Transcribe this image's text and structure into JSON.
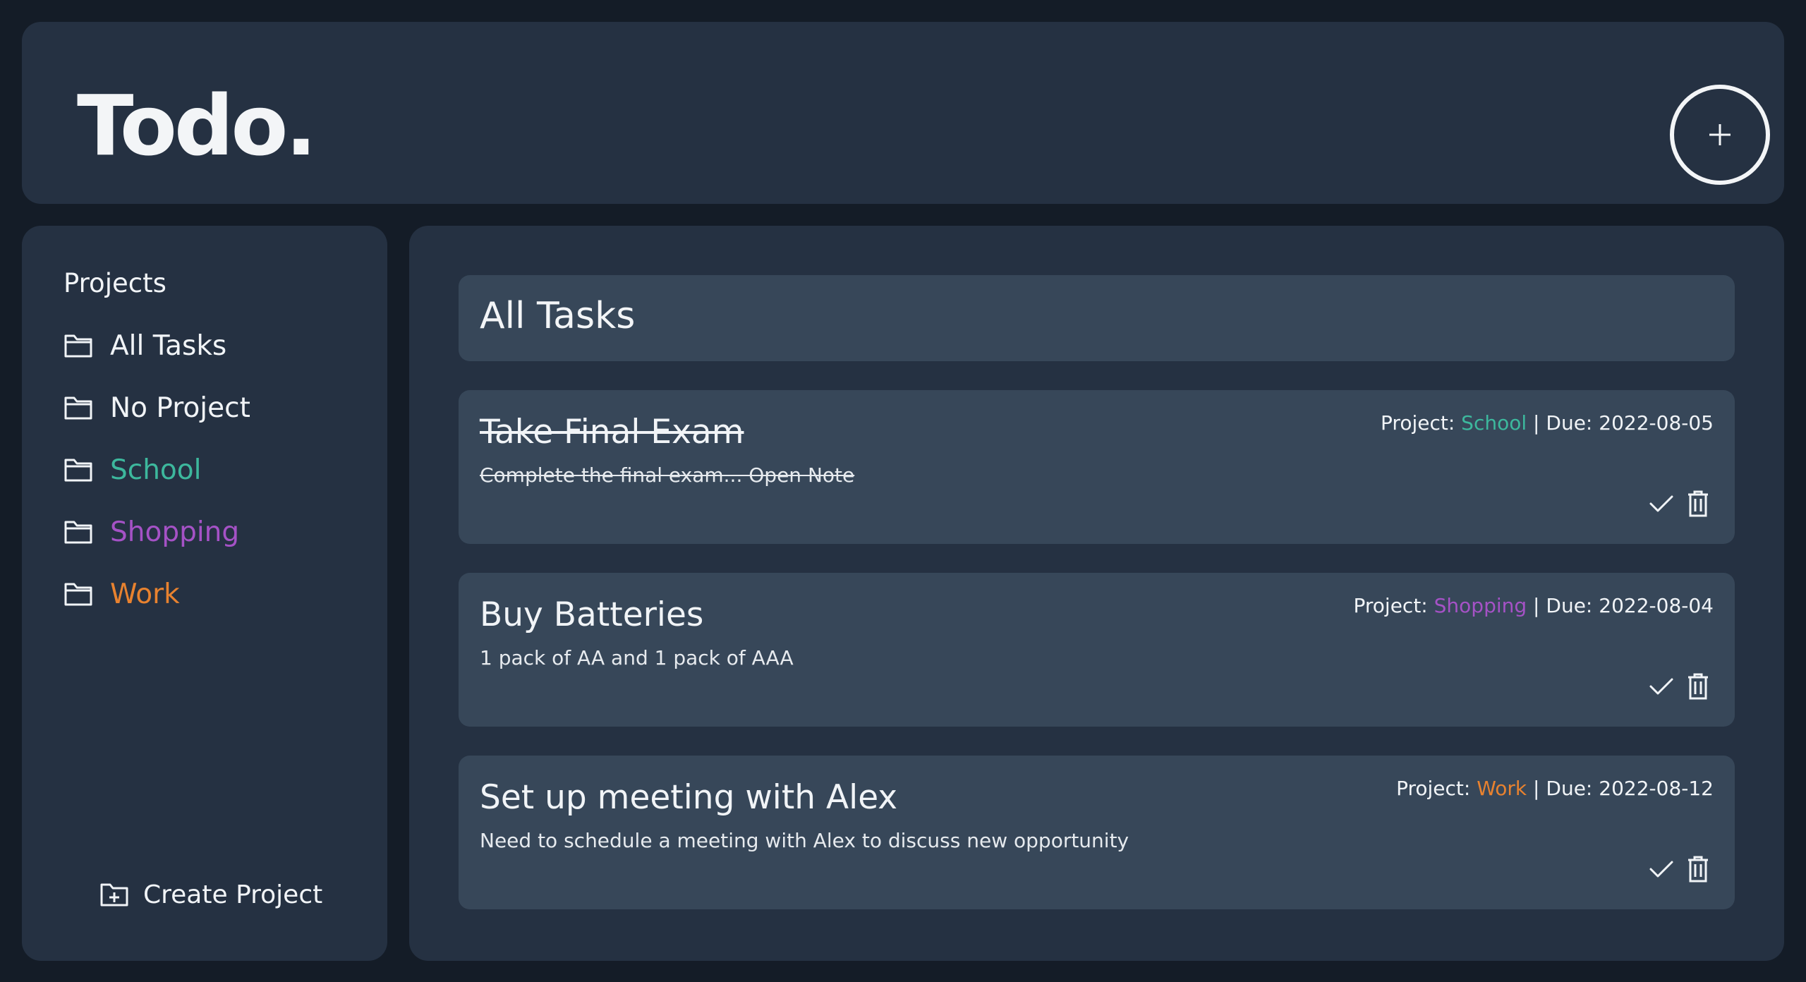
{
  "header": {
    "logo": "Todo.",
    "add_icon": "plus-icon"
  },
  "colors": {
    "background": "#141c27",
    "panel": "#253142",
    "card": "#374759",
    "text": "#f1f4f7",
    "school": "#3db89d",
    "shopping": "#a552c6",
    "work": "#e8822f"
  },
  "sidebar": {
    "heading": "Projects",
    "items": [
      {
        "label": "All Tasks",
        "icon": "folder-icon",
        "color": "#f1f4f7"
      },
      {
        "label": "No Project",
        "icon": "folder-icon",
        "color": "#f1f4f7"
      },
      {
        "label": "School",
        "icon": "folder-icon",
        "color": "#3db89d"
      },
      {
        "label": "Shopping",
        "icon": "folder-icon",
        "color": "#a552c6"
      },
      {
        "label": "Work",
        "icon": "folder-icon",
        "color": "#e8822f"
      }
    ],
    "create_label": "Create Project",
    "create_icon": "folder-plus-icon"
  },
  "main": {
    "title": "All Tasks",
    "tasks": [
      {
        "title": "Take Final Exam",
        "description": "Complete the final exam... Open Note",
        "project_prefix": "Project:",
        "project": "School",
        "project_color": "#3db89d",
        "separator": "|",
        "due_prefix": "Due:",
        "due": "2022-08-05",
        "completed": true
      },
      {
        "title": "Buy Batteries",
        "description": "1 pack of AA and 1 pack of AAA",
        "project_prefix": "Project:",
        "project": "Shopping",
        "project_color": "#a552c6",
        "separator": "|",
        "due_prefix": "Due:",
        "due": "2022-08-04",
        "completed": false
      },
      {
        "title": "Set up meeting with Alex",
        "description": "Need to schedule a meeting with Alex to discuss new opportunity",
        "project_prefix": "Project:",
        "project": "Work",
        "project_color": "#e8822f",
        "separator": "|",
        "due_prefix": "Due:",
        "due": "2022-08-12",
        "completed": false
      }
    ]
  }
}
